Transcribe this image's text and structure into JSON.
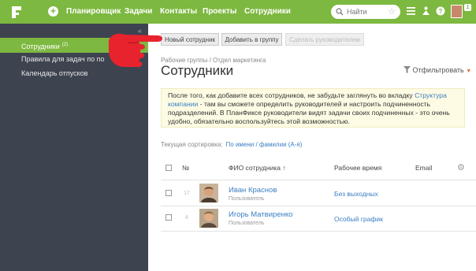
{
  "topbar": {
    "nav": [
      {
        "label": "Планировщик"
      },
      {
        "label": "Задачи"
      },
      {
        "label": "Контакты"
      },
      {
        "label": "Проекты"
      },
      {
        "label": "Сотрудники"
      }
    ],
    "search_placeholder": "Найти",
    "notification_count": "1"
  },
  "sidebar": {
    "collapse_icon": "«",
    "items": [
      {
        "label": "Сотрудники",
        "badge": "(2)"
      },
      {
        "label": "Правила для задач по по"
      },
      {
        "label": "Календарь отпусков"
      }
    ]
  },
  "toolbar": {
    "new_employee": "Новый сотрудник",
    "add_to_group": "Добавить в группу",
    "assign_manager": "Сделать руководителем"
  },
  "breadcrumb": "Рабочие группы / Отдел маркетинга",
  "page_title": "Сотрудники",
  "filter_label": "Отфильтровать",
  "info": {
    "text_before": "После того, как добавите всех сотрудников, не забудьте заглянуть во вкладку ",
    "link": "Структура компании",
    "text_after": " - там вы сможете определить руководителей и настроить подчиненность подразделений. В ПланФиксе руководители видят задачи своих подчиненных - это очень удобно, обязательно воспользуйтесь этой возможностью."
  },
  "sort": {
    "label": "Текущая сортировка:",
    "value": "По имени / фамилии (А-я)"
  },
  "table": {
    "headers": {
      "num": "№",
      "name": "ФИО сотрудника",
      "name_sort": "↑",
      "schedule": "Рабочее время",
      "email": "Email"
    },
    "rows": [
      {
        "num": "17",
        "name": "Иван Краснов",
        "role": "Пользователь",
        "schedule": "Без выходных"
      },
      {
        "num": "4",
        "name": "Игорь Матвиренко",
        "role": "Пользователь",
        "schedule": "Особый график"
      }
    ]
  },
  "colors": {
    "brand_green": "#7db840",
    "sidebar_bg": "#3e4350",
    "link_blue": "#3b7fc4",
    "info_bg": "#fdfbe3",
    "hand_red": "#e8232e"
  }
}
